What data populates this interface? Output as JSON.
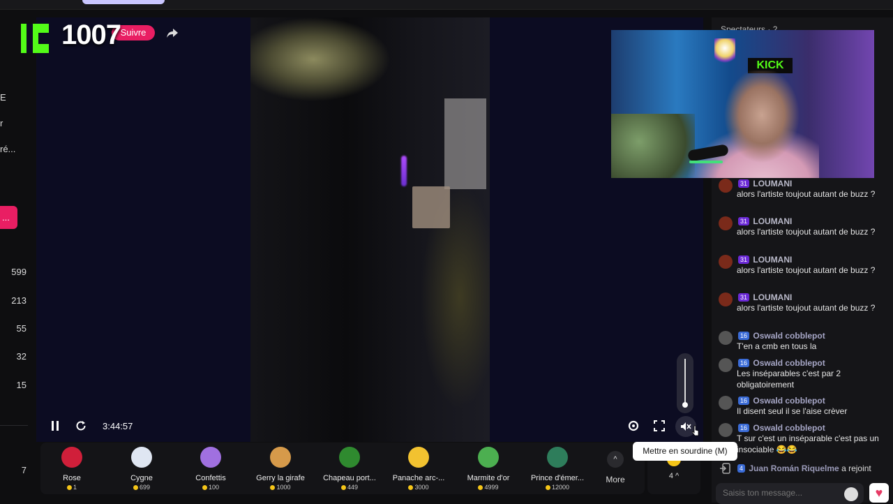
{
  "left_rail": {
    "labels": [
      "E",
      "r",
      "ré...",
      "..."
    ],
    "numbers": [
      "599",
      "213",
      "55",
      "32",
      "15"
    ],
    "bottom_number": "7"
  },
  "player": {
    "channel_name": "1007",
    "follow_label": "Suivre",
    "time": "3:44:57",
    "volume_level": 0.0,
    "tooltip": "Mettre en sourdine (M)"
  },
  "gifts": {
    "items": [
      {
        "name": "Rose",
        "price": "1",
        "color": "#d01f3a"
      },
      {
        "name": "Cygne",
        "price": "699",
        "color": "#dfe6f2"
      },
      {
        "name": "Confettis",
        "price": "100",
        "color": "#a070e0"
      },
      {
        "name": "Gerry la girafe",
        "price": "1000",
        "color": "#d69a4a"
      },
      {
        "name": "Chapeau port...",
        "price": "449",
        "color": "#2f8a2f"
      },
      {
        "name": "Panache arc-...",
        "price": "3000",
        "color": "#f2c230"
      },
      {
        "name": "Marmite d'or",
        "price": "4999",
        "color": "#4caf50"
      },
      {
        "name": "Prince d'émer...",
        "price": "12000",
        "color": "#2e7d5b"
      }
    ],
    "more_label": "More",
    "right_count": "4"
  },
  "chat": {
    "header": "Spectateurs · 2",
    "webcam_sign": "KICK",
    "messages": [
      {
        "badge": "31",
        "badge_color": "purple",
        "user": "LOUMANI",
        "user_color": "#b9b9c9",
        "text": "alors l'artiste toujout autant de buzz ?",
        "avatar": "#7a2a1a"
      },
      {
        "badge": "31",
        "badge_color": "purple",
        "user": "LOUMANI",
        "user_color": "#b9b9c9",
        "text": "alors l'artiste toujout autant de buzz ?",
        "avatar": "#7a2a1a"
      },
      {
        "badge": "31",
        "badge_color": "purple",
        "user": "LOUMANI",
        "user_color": "#b9b9c9",
        "text": "alors l'artiste toujout autant de buzz ?",
        "avatar": "#7a2a1a"
      },
      {
        "badge": "31",
        "badge_color": "purple",
        "user": "LOUMANI",
        "user_color": "#b9b9c9",
        "text": "alors l'artiste toujout autant de buzz ?",
        "avatar": "#7a2a1a"
      },
      {
        "badge": "16",
        "badge_color": "blue",
        "user": "Oswald cobblepot",
        "user_color": "#a6a6c6",
        "text": "T'en a cmb en tous la",
        "avatar": "#555"
      },
      {
        "badge": "16",
        "badge_color": "blue",
        "user": "Oswald cobblepot",
        "user_color": "#a6a6c6",
        "text": "Les inséparables c'est par 2 obligatoirement",
        "avatar": "#555"
      },
      {
        "badge": "16",
        "badge_color": "blue",
        "user": "Oswald cobblepot",
        "user_color": "#a6a6c6",
        "text": "Il disent seul il se l'aise crèver",
        "avatar": "#555"
      },
      {
        "badge": "16",
        "badge_color": "blue",
        "user": "Oswald cobblepot",
        "user_color": "#a6a6c6",
        "text": "T sur c'est un inséparable c'est pas un insociable 😂😂",
        "avatar": "#555"
      }
    ],
    "join": {
      "badge": "4",
      "user": "Juan Román Riquelme",
      "text": "a rejoint"
    },
    "input_placeholder": "Saisis ton message..."
  }
}
